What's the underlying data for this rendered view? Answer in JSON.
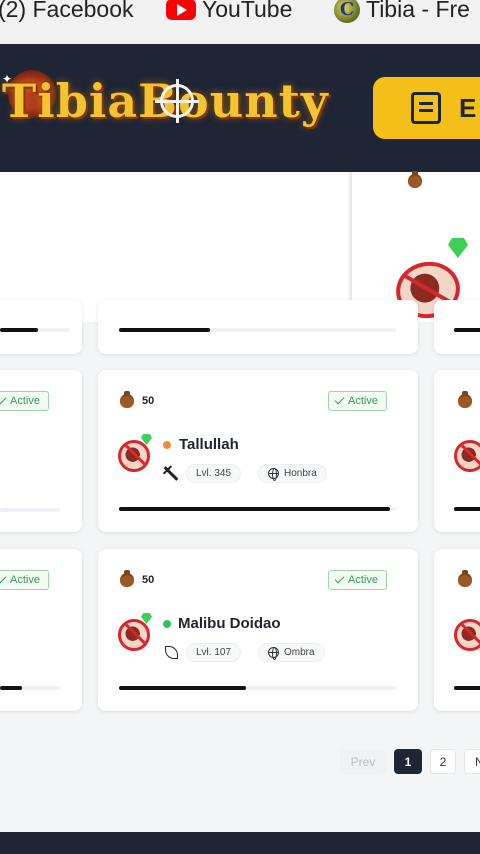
{
  "bookmarks": [
    {
      "label": "(2) Facebook"
    },
    {
      "label": "YouTube"
    },
    {
      "label": "Tibia - Fre"
    }
  ],
  "header": {
    "logo_text": "TibiaBounty",
    "button_label": "E"
  },
  "cards": [
    {
      "bounty": "50",
      "status": "Active",
      "name": "Tallullah",
      "status_color": "#f08a3c",
      "level": "Lvl. 345",
      "world": "Honbra",
      "progress": 0.98
    },
    {
      "bounty": "50",
      "status": "Active",
      "name": "Malibu Doidao",
      "status_color": "#2ec25a",
      "level": "Lvl. 107",
      "world": "Ombra",
      "progress": 0.46
    }
  ],
  "side_cards": {
    "left_status": "Active",
    "top_center_progress": 0.33
  },
  "pagination": {
    "prev": "Prev",
    "pages": [
      "1",
      "2"
    ],
    "next": "N",
    "active": "1"
  },
  "colors": {
    "header_bg": "#1e2535",
    "accent": "#f5bf1a",
    "active_green": "#3a9a52"
  }
}
